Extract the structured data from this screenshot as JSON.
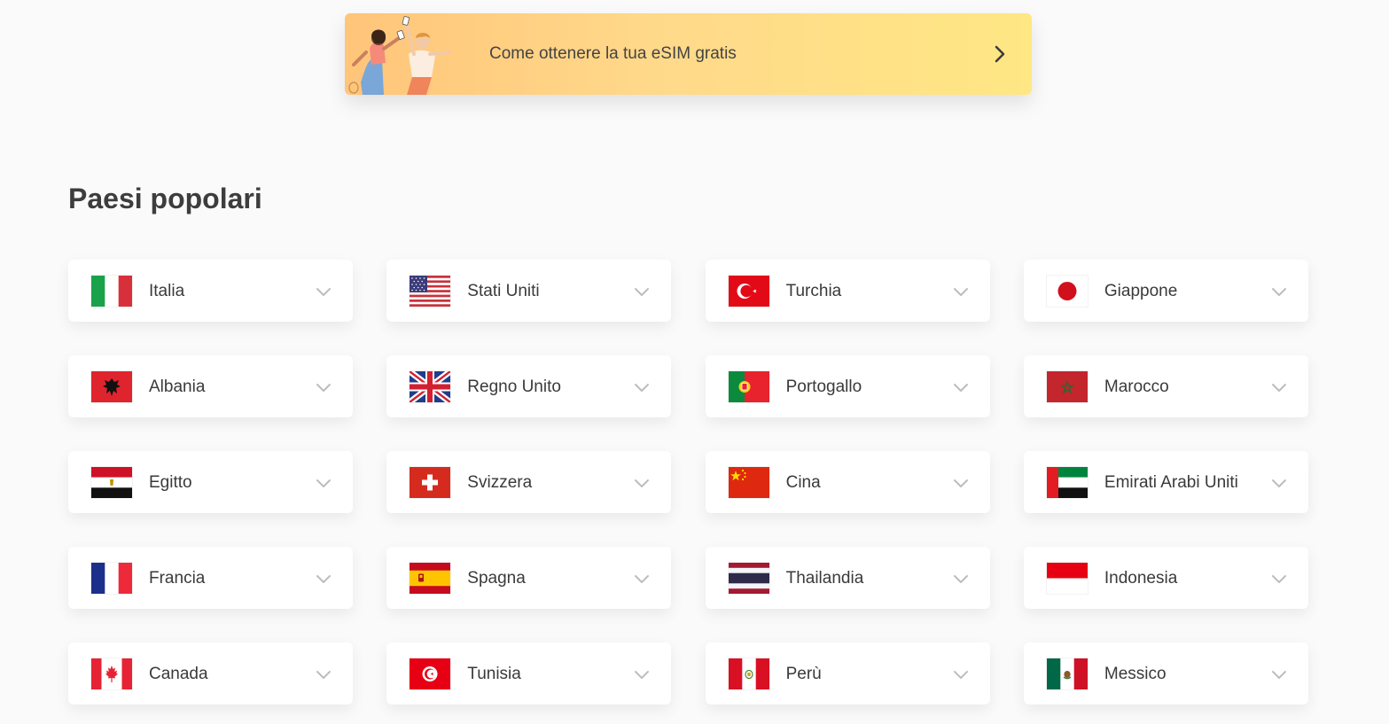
{
  "promo": {
    "text": "Come ottenere la tua eSIM gratis",
    "icon": "chevron-right-icon"
  },
  "popular": {
    "title": "Paesi popolari",
    "countries": [
      {
        "name": "Italia",
        "flag": "italy-flag"
      },
      {
        "name": "Stati Uniti",
        "flag": "usa-flag"
      },
      {
        "name": "Turchia",
        "flag": "turkey-flag"
      },
      {
        "name": "Giappone",
        "flag": "japan-flag"
      },
      {
        "name": "Albania",
        "flag": "albania-flag"
      },
      {
        "name": "Regno Unito",
        "flag": "uk-flag"
      },
      {
        "name": "Portogallo",
        "flag": "portugal-flag"
      },
      {
        "name": "Marocco",
        "flag": "morocco-flag"
      },
      {
        "name": "Egitto",
        "flag": "egypt-flag"
      },
      {
        "name": "Svizzera",
        "flag": "switzerland-flag"
      },
      {
        "name": "Cina",
        "flag": "china-flag"
      },
      {
        "name": "Emirati Arabi Uniti",
        "flag": "uae-flag"
      },
      {
        "name": "Francia",
        "flag": "france-flag"
      },
      {
        "name": "Spagna",
        "flag": "spain-flag"
      },
      {
        "name": "Thailandia",
        "flag": "thailand-flag"
      },
      {
        "name": "Indonesia",
        "flag": "indonesia-flag"
      },
      {
        "name": "Canada",
        "flag": "canada-flag"
      },
      {
        "name": "Tunisia",
        "flag": "tunisia-flag"
      },
      {
        "name": "Perù",
        "flag": "peru-flag"
      },
      {
        "name": "Messico",
        "flag": "mexico-flag"
      }
    ]
  },
  "colors": {
    "background": "#fafafa",
    "promo_gradient_start": "#ffc57a",
    "promo_gradient_end": "#ffe784",
    "text": "#3a3a3a",
    "chevron": "#b8b8b8"
  }
}
